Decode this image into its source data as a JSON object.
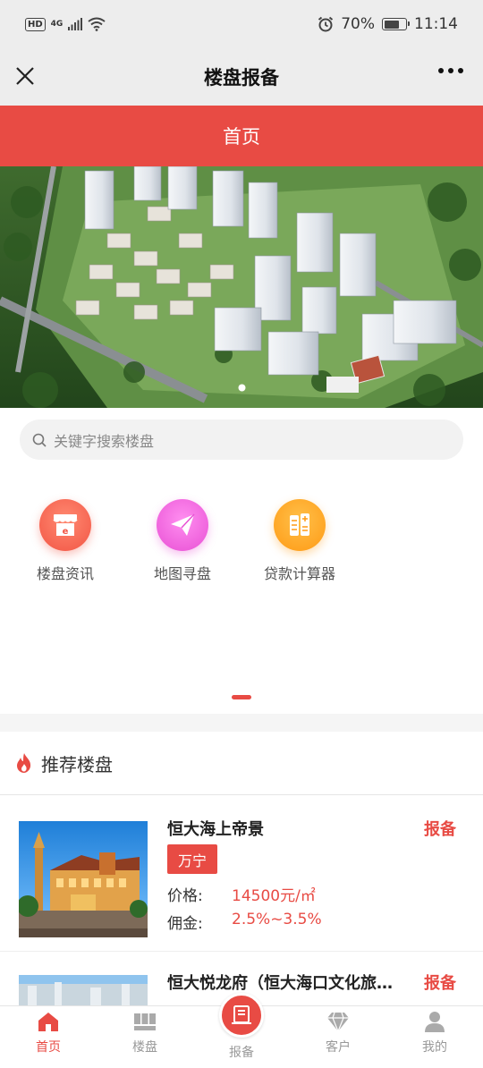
{
  "status_bar": {
    "hd": "HD",
    "network": "4G",
    "battery": "70%",
    "battery_level": 0.7,
    "time": "11:14",
    "icons": [
      "signal-icon",
      "wifi-icon",
      "alarm-icon",
      "battery-icon"
    ]
  },
  "nav": {
    "title": "楼盘报备",
    "close_icon": "close-icon",
    "more_icon": "more-icon"
  },
  "header": {
    "title": "首页"
  },
  "banner": {
    "slide_count": 1,
    "active_slide": 1
  },
  "search": {
    "placeholder": "关键字搜索楼盘",
    "icon": "search-icon"
  },
  "quick_menu": [
    {
      "label": "楼盘资讯",
      "icon": "shop-icon",
      "color": "#ff6a55"
    },
    {
      "label": "地图寻盘",
      "icon": "paper-plane-icon",
      "color": "#f46be0"
    },
    {
      "label": "贷款计算器",
      "icon": "calculator-icon",
      "color": "#ffa31a"
    }
  ],
  "recommend": {
    "title": "推荐楼盘",
    "icon": "flame-icon",
    "listings": [
      {
        "name": "恒大海上帝景",
        "tag": "万宁",
        "report_label": "报备",
        "price_label": "价格:",
        "price": "14500元/㎡",
        "commission_label": "佣金:",
        "commission": "2.5%~3.5%"
      },
      {
        "name": "恒大悦龙府（恒大海口文化旅游城）",
        "report_label": "报备"
      }
    ]
  },
  "tabbar": {
    "tabs": [
      {
        "label": "首页",
        "icon": "home-icon",
        "active": true
      },
      {
        "label": "楼盘",
        "icon": "buildings-icon",
        "active": false
      },
      {
        "label": "报备",
        "icon": "report-icon",
        "active": false
      },
      {
        "label": "客户",
        "icon": "diamond-icon",
        "active": false
      },
      {
        "label": "我的",
        "icon": "user-icon",
        "active": false
      }
    ]
  },
  "colors": {
    "primary": "#e84b44",
    "nav_bg": "#ededed"
  }
}
